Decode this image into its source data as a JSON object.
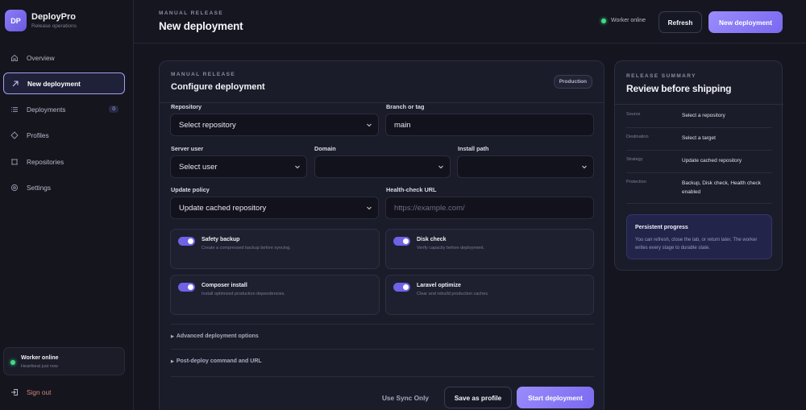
{
  "brand": {
    "initials": "DP",
    "name": "DeployPro",
    "subtitle": "Release operations"
  },
  "sidebar": {
    "items": [
      {
        "label": "Overview",
        "icon": "home-icon"
      },
      {
        "label": "New deployment",
        "icon": "arrow-up-right-icon",
        "active": true
      },
      {
        "label": "Deployments",
        "icon": "list-icon",
        "badge": "0"
      },
      {
        "label": "Profiles",
        "icon": "diamond-icon"
      },
      {
        "label": "Repositories",
        "icon": "repository-icon"
      },
      {
        "label": "Settings",
        "icon": "gear-icon"
      }
    ],
    "worker": {
      "title": "Worker online",
      "subtitle": "Heartbeat just now",
      "status_color": "#3ddc84"
    },
    "signout_label": "Sign out"
  },
  "header": {
    "eyebrow": "MANUAL RELEASE",
    "title": "New deployment",
    "status": "Worker online",
    "refresh_label": "Refresh",
    "new_label": "New deployment",
    "accent": "#8b7cf6"
  },
  "form": {
    "eyebrow": "MANUAL RELEASE",
    "title": "Configure deployment",
    "environment_badge": "Production",
    "repository": {
      "label": "Repository",
      "value": "Select repository"
    },
    "branch": {
      "label": "Branch or tag",
      "value": "main"
    },
    "server_user": {
      "label": "Server user",
      "value": "Select user"
    },
    "domain": {
      "label": "Domain",
      "value": ""
    },
    "install_path": {
      "label": "Install path",
      "value": ""
    },
    "update_policy": {
      "label": "Update policy",
      "value": "Update cached repository"
    },
    "health_check": {
      "label": "Health-check URL",
      "placeholder": "https://example.com/"
    },
    "toggles": [
      {
        "title": "Safety backup",
        "desc": "Create a compressed backup before syncing.",
        "on": true
      },
      {
        "title": "Disk check",
        "desc": "Verify capacity before deployment.",
        "on": true
      },
      {
        "title": "Composer install",
        "desc": "Install optimized production dependencies.",
        "on": true
      },
      {
        "title": "Laravel optimize",
        "desc": "Clear and rebuild production caches.",
        "on": true
      }
    ],
    "advanced_label": "Advanced deployment options",
    "post_deploy_label": "Post-deploy command and URL",
    "sync_only_label": "Use Sync Only",
    "save_profile_label": "Save as profile",
    "start_label": "Start deployment"
  },
  "summary": {
    "eyebrow": "RELEASE SUMMARY",
    "title": "Review before shipping",
    "rows": [
      {
        "key": "Source",
        "value": "Select a repository"
      },
      {
        "key": "Destination",
        "value": "Select a target"
      },
      {
        "key": "Strategy",
        "value": "Update cached repository"
      },
      {
        "key": "Protection",
        "value": "Backup, Disk check, Health check enabled"
      }
    ],
    "progress": {
      "title": "Persistent progress",
      "desc": "You can refresh, close the tab, or return later. The worker writes every stage to durable state."
    }
  }
}
